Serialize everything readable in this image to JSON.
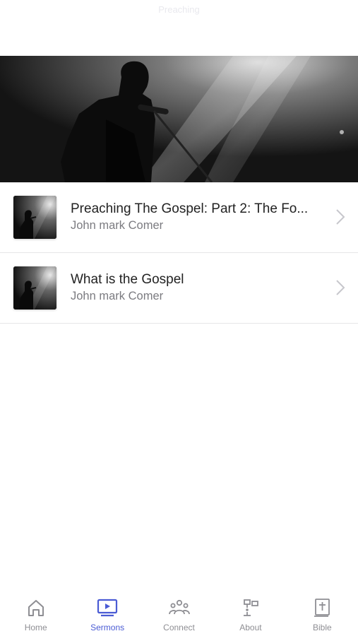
{
  "header": {
    "title": "Preaching"
  },
  "sermons": [
    {
      "title": "Preaching The Gospel: Part 2: The Fo...",
      "speaker": "John mark Comer"
    },
    {
      "title": "What is the Gospel",
      "speaker": "John mark Comer"
    }
  ],
  "tabbar": {
    "active": "Sermons",
    "accent_color": "#4a5bd4",
    "inactive_color": "#8e8e93",
    "tabs": [
      {
        "label": "Home",
        "icon": "home-icon"
      },
      {
        "label": "Sermons",
        "icon": "video-play-icon"
      },
      {
        "label": "Connect",
        "icon": "people-icon"
      },
      {
        "label": "About",
        "icon": "signpost-icon"
      },
      {
        "label": "Bible",
        "icon": "bible-icon"
      }
    ]
  }
}
